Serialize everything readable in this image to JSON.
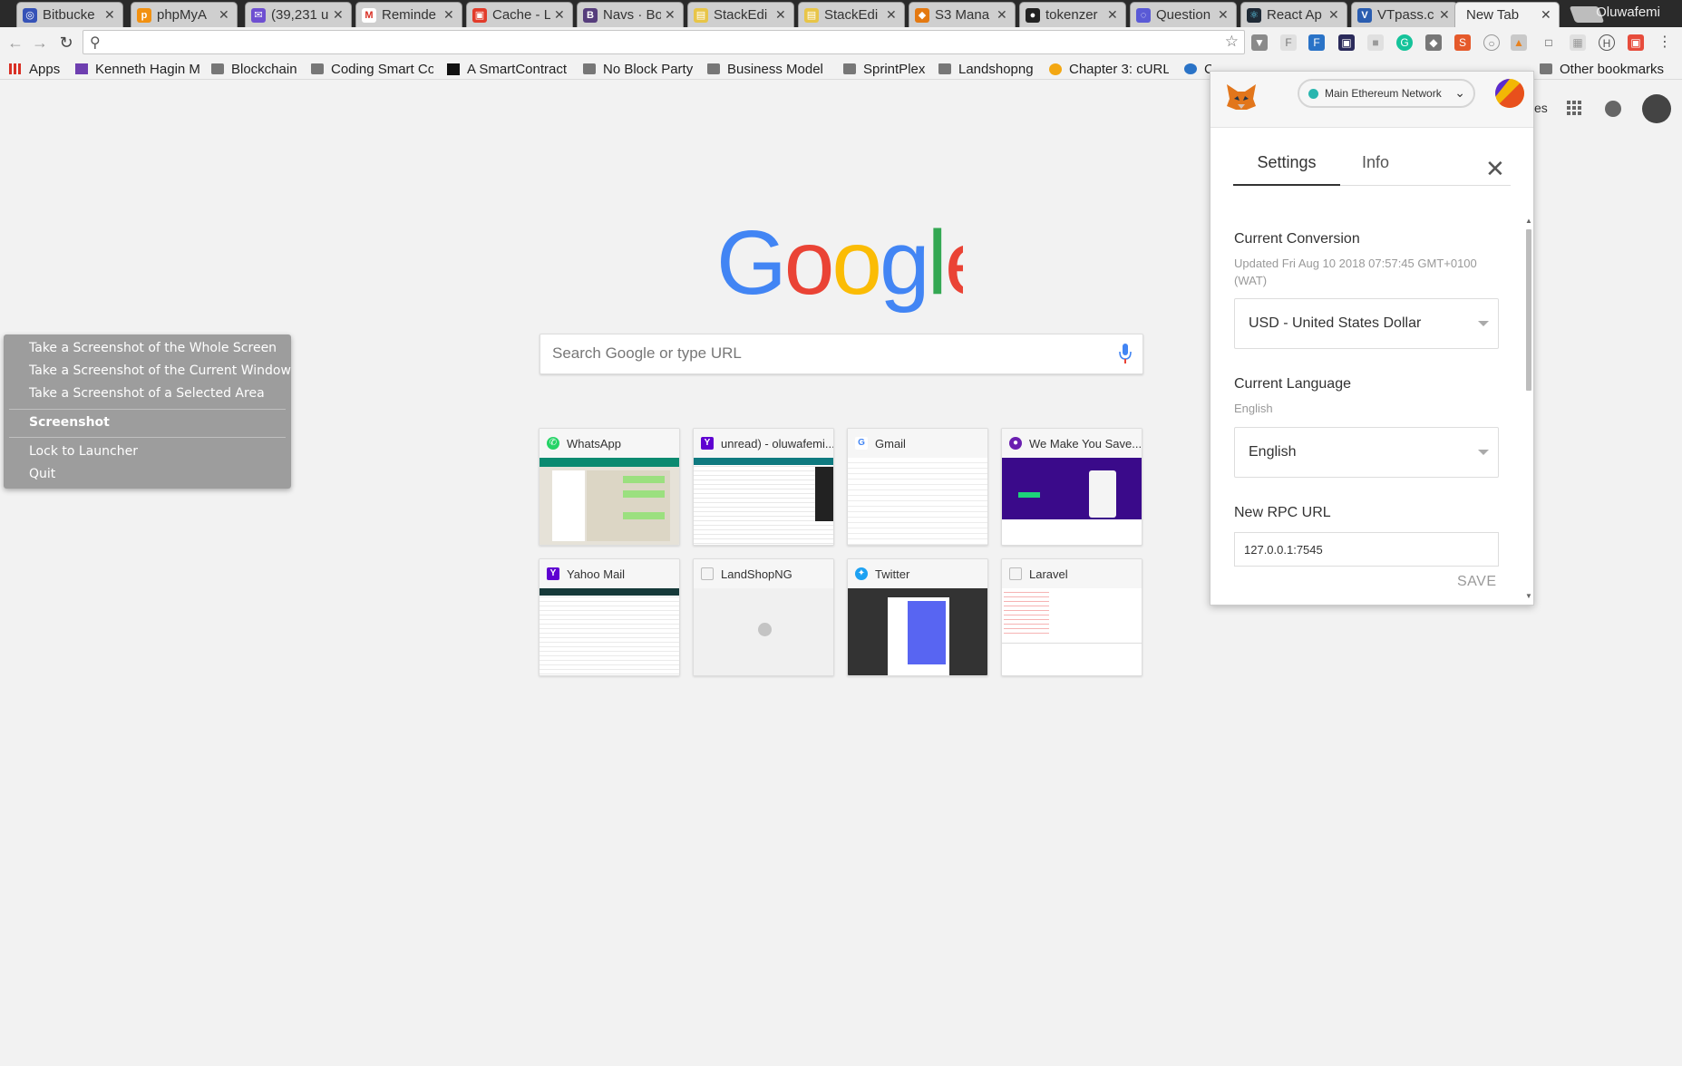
{
  "tabs": [
    {
      "title": "Bitbucke",
      "color": "#3552b7",
      "glyph": "◎"
    },
    {
      "title": "phpMyA",
      "color": "#f29111",
      "glyph": "p"
    },
    {
      "title": "(39,231 u",
      "color": "#6e4fd1",
      "glyph": "✉"
    },
    {
      "title": "Reminde",
      "color": "#d93025",
      "glyph": "M"
    },
    {
      "title": "Cache - L",
      "color": "#e23b2a",
      "glyph": "▣"
    },
    {
      "title": "Navs · Bo",
      "color": "#563d7c",
      "glyph": "B"
    },
    {
      "title": "StackEdi",
      "color": "#e8c547",
      "glyph": "▤"
    },
    {
      "title": "StackEdi",
      "color": "#e8c547",
      "glyph": "▤"
    },
    {
      "title": "S3 Mana",
      "color": "#e47911",
      "glyph": "◆"
    },
    {
      "title": "tokenzer",
      "color": "#222222",
      "glyph": "●"
    },
    {
      "title": "Question",
      "color": "#5a5ad6",
      "glyph": "◌"
    },
    {
      "title": "React Ap",
      "color": "#1f2a36",
      "glyph": "⚛"
    },
    {
      "title": "VTpass.c",
      "color": "#2a5db0",
      "glyph": "V"
    },
    {
      "title": "New Tab",
      "color": "",
      "glyph": ""
    }
  ],
  "profile_name": "Oluwafemi",
  "omnibox": {
    "value": "",
    "placeholder": ""
  },
  "bookmarks": [
    {
      "label": "Apps",
      "icon": "apps-icon"
    },
    {
      "label": "Kenneth Hagin M",
      "icon": "page-icon"
    },
    {
      "label": "Blockchain",
      "icon": "folder-icon"
    },
    {
      "label": "Coding Smart Co",
      "icon": "folder-icon"
    },
    {
      "label": "A SmartContract",
      "icon": "medium-icon"
    },
    {
      "label": "No Block Party",
      "icon": "folder-icon"
    },
    {
      "label": "Business Model",
      "icon": "folder-icon"
    },
    {
      "label": "SprintPlex",
      "icon": "folder-icon"
    },
    {
      "label": "Landshopng",
      "icon": "folder-icon"
    },
    {
      "label": "Chapter 3: cURL",
      "icon": "page-icon"
    },
    {
      "label": "C",
      "icon": "page-icon"
    },
    {
      "label": "Other bookmarks",
      "icon": "folder-icon"
    }
  ],
  "ntp": {
    "search_placeholder": "Search Google or type URL",
    "right_partial_text": "es",
    "tiles": [
      {
        "title": "WhatsApp",
        "fav_color": "#25d366"
      },
      {
        "title": "unread) - oluwafemi...",
        "fav_color": "#5f01d1"
      },
      {
        "title": "Gmail",
        "fav_color": "#ffffff"
      },
      {
        "title": "We Make You Save...",
        "fav_color": "#6a1fb0"
      },
      {
        "title": "Yahoo Mail",
        "fav_color": "#5f01d1"
      },
      {
        "title": "LandShopNG",
        "fav_color": "#dddddd"
      },
      {
        "title": "Twitter",
        "fav_color": "#1da1f2"
      },
      {
        "title": "Laravel",
        "fav_color": "#dddddd"
      }
    ]
  },
  "context_menu": {
    "items": [
      "Take a Screenshot of the Whole Screen",
      "Take a Screenshot of the Current Window",
      "Take a Screenshot of a Selected Area",
      "Screenshot",
      "Lock to Launcher",
      "Quit"
    ]
  },
  "metamask": {
    "network": "Main Ethereum Network",
    "tabs": [
      "Settings",
      "Info"
    ],
    "conversion_label": "Current Conversion",
    "conversion_updated": "Updated Fri Aug 10 2018 07:57:45 GMT+0100 (WAT)",
    "currency": "USD - United States Dollar",
    "language_label": "Current Language",
    "language_sub": "English",
    "language": "English",
    "rpc_label": "New RPC URL",
    "rpc_value": "127.0.0.1:7545",
    "save": "SAVE"
  }
}
